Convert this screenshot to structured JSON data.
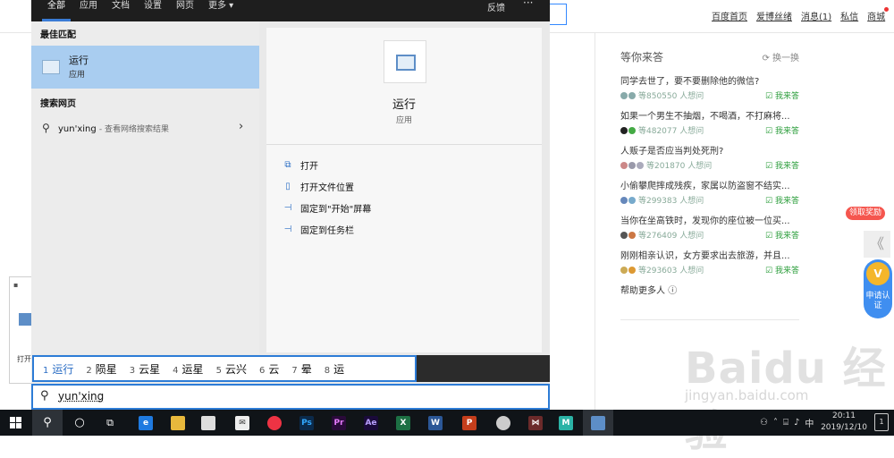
{
  "browser_page": {
    "nav_links": [
      "百度首页",
      "爱博丝绪",
      "消息(1)",
      "私信",
      "商城"
    ],
    "qa_panel": {
      "title": "等你来答",
      "refresh": "换一换",
      "items": [
        {
          "question": "同学去世了，要不要删除他的微信?",
          "count": "等850550 人想问",
          "answer": "我来答"
        },
        {
          "question": "如果一个男生不抽烟，不喝酒，不打麻将...",
          "count": "等482077 人想问",
          "answer": "我来答"
        },
        {
          "question": "人贩子是否应当判处死刑?",
          "count": "等201870 人想问",
          "answer": "我来答"
        },
        {
          "question": "小偷攀爬摔成残疾，家属以防盗窗不结实...",
          "count": "等299383 人想问",
          "answer": "我来答"
        },
        {
          "question": "当你在坐高铁时，发现你的座位被一位买...",
          "count": "等276409 人想问",
          "answer": "我来答"
        },
        {
          "question": "刚刚相亲认识，女方要求出去旅游，并且...",
          "count": "等293603 人想问",
          "answer": "我来答"
        }
      ],
      "help_more": "帮助更多人"
    },
    "promo_label": "领取奖励",
    "side_arrow": "《",
    "apply_badge": "申请认证",
    "watermark": "Baidu 经验",
    "watermark_sub": "jingyan.baidu.com"
  },
  "run_dialog": {
    "label": "打开"
  },
  "start_menu": {
    "tabs": [
      "全部",
      "应用",
      "文档",
      "设置",
      "网页",
      "更多 ▾"
    ],
    "feedback": "反馈",
    "more_dots": "···",
    "best_match_label": "最佳匹配",
    "best_match": {
      "name": "运行",
      "type": "应用"
    },
    "web_label": "搜索网页",
    "web_result": {
      "query": "yun'xing",
      "suffix": "- 查看网络搜索结果"
    },
    "detail": {
      "name": "运行",
      "type": "应用",
      "actions": [
        "打开",
        "打开文件位置",
        "固定到\"开始\"屏幕",
        "固定到任务栏"
      ]
    }
  },
  "ime": {
    "candidates": [
      {
        "n": "1",
        "text": "运行"
      },
      {
        "n": "2",
        "text": "陨星"
      },
      {
        "n": "3",
        "text": "云星"
      },
      {
        "n": "4",
        "text": "运星"
      },
      {
        "n": "5",
        "text": "云兴"
      },
      {
        "n": "6",
        "text": "云"
      },
      {
        "n": "7",
        "text": "晕"
      },
      {
        "n": "8",
        "text": "运"
      }
    ]
  },
  "search": {
    "value": "yun'xing"
  },
  "taskbar": {
    "ime_indicator": "中",
    "time": "20:11",
    "date": "2019/12/10",
    "notification_count": "1"
  }
}
